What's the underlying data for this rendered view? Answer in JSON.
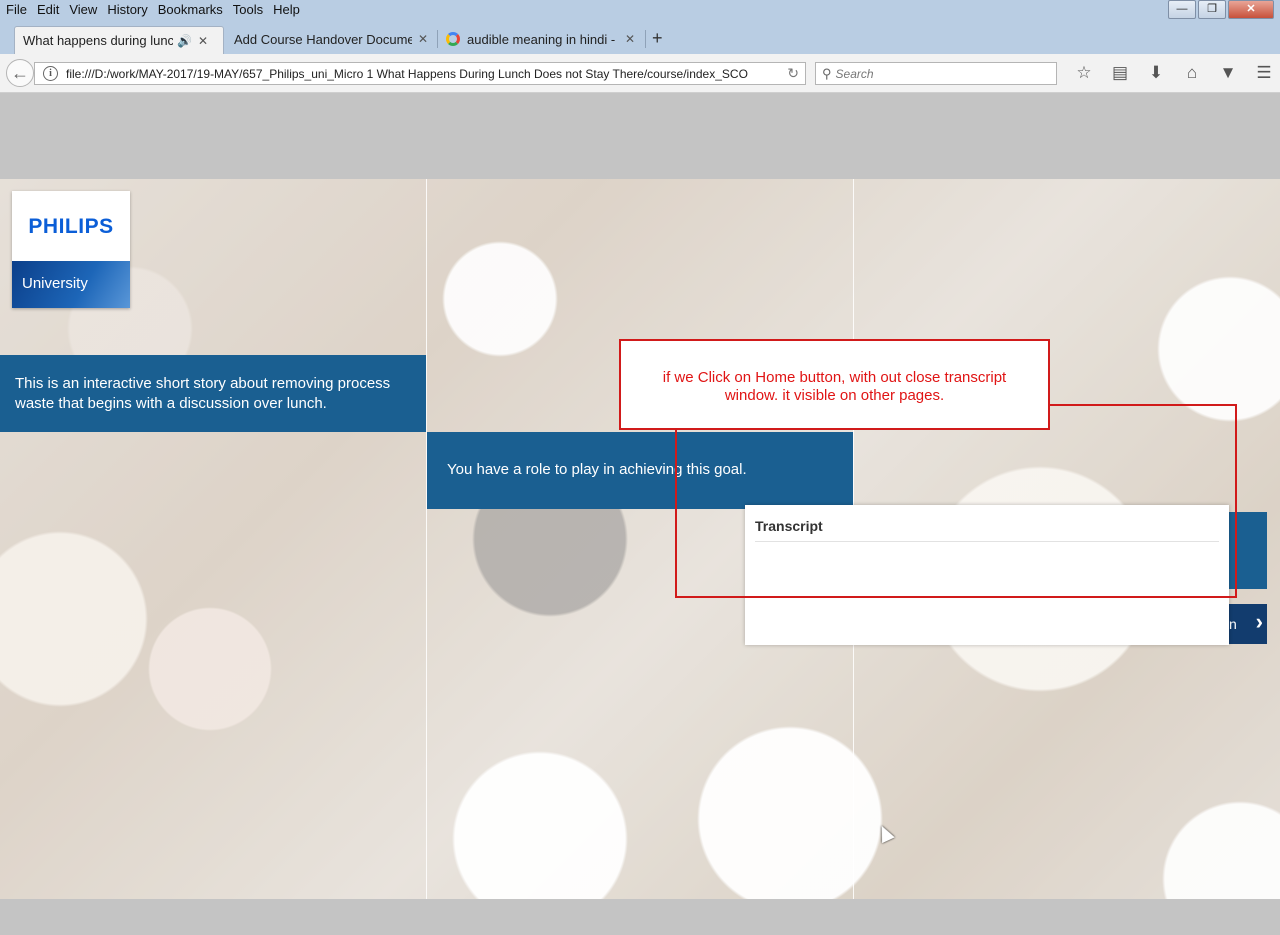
{
  "browser": {
    "menu": [
      "File",
      "Edit",
      "View",
      "History",
      "Bookmarks",
      "Tools",
      "Help"
    ],
    "tabs": [
      {
        "title": "What happens during lunch d"
      },
      {
        "title": "Add Course Handover Document"
      },
      {
        "title": "audible meaning in hindi - G"
      }
    ],
    "url": "file:///D:/work/MAY-2017/19-MAY/657_Philips_uni_Micro 1 What Happens During Lunch Does not Stay There/course/index_SCO",
    "search_placeholder": "Search"
  },
  "course": {
    "logo_brand": "PHILIPS",
    "logo_sub": "University",
    "intro_text": "This is an interactive short story about removing process waste that begins with a discussion over lunch.",
    "role_text": "You have a role to play in achieving this goal.",
    "next_label": "n",
    "transcript_title": "Transcript"
  },
  "annotation": {
    "note": "if we Click on Home button, with out close transcript window.  it visible on other pages.",
    "color": "#e01414"
  }
}
